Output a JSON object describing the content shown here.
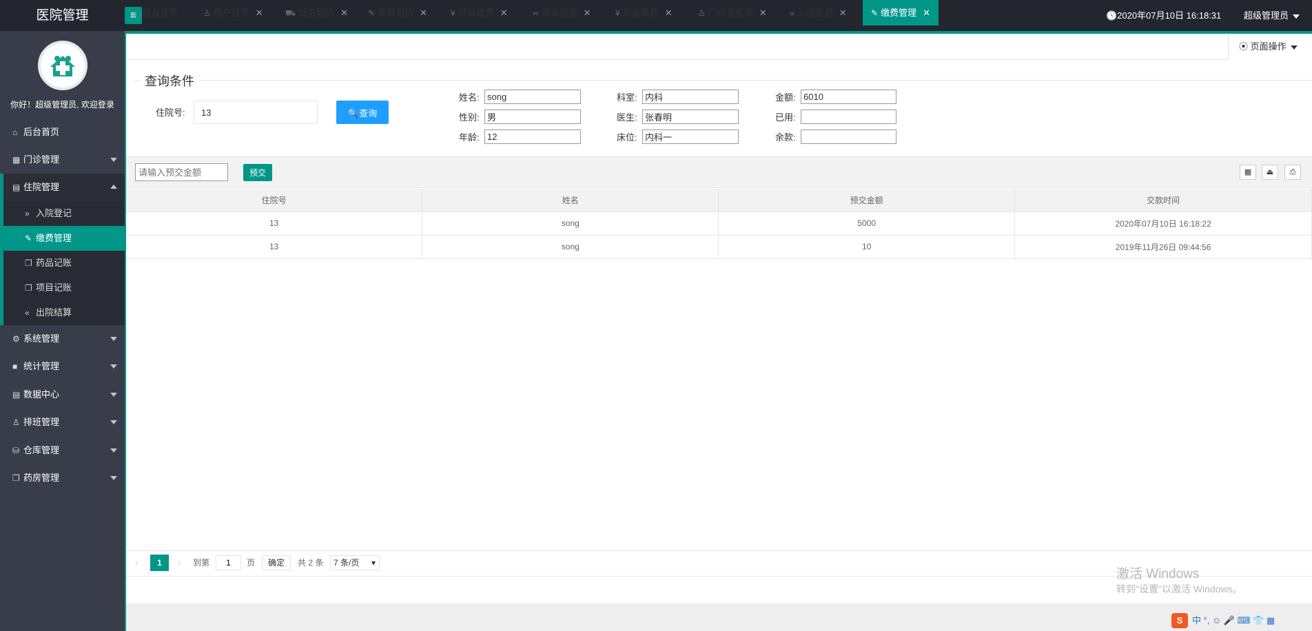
{
  "app": {
    "title": "医院管理",
    "menu_toggle": "≡",
    "datetime": "🕓2020年07月10日 16:18:31",
    "user": "超级管理员"
  },
  "sidebar": {
    "welcome": "你好！超级管理员, 欢迎登录",
    "items": [
      {
        "label": "后台首页",
        "icon": "⌂"
      },
      {
        "label": "门诊管理",
        "icon": "▦"
      },
      {
        "label": "住院管理",
        "icon": "▤"
      },
      {
        "label": "系统管理",
        "icon": "⚙"
      },
      {
        "label": "统计管理",
        "icon": "■"
      },
      {
        "label": "数据中心",
        "icon": "▤"
      },
      {
        "label": "排班管理",
        "icon": "♙"
      },
      {
        "label": "仓库管理",
        "icon": "⛁"
      },
      {
        "label": "药房管理",
        "icon": "❐"
      }
    ],
    "sub_items": [
      {
        "label": "入院登记",
        "icon": "»"
      },
      {
        "label": "缴费管理",
        "icon": "✎"
      },
      {
        "label": "药品记账",
        "icon": "❐"
      },
      {
        "label": "项目记账",
        "icon": "❐"
      },
      {
        "label": "出院结算",
        "icon": "«"
      }
    ]
  },
  "tabs": [
    {
      "label": "后台首页",
      "icon": "⌂"
    },
    {
      "label": "用户挂号",
      "icon": "♙"
    },
    {
      "label": "处方划价",
      "icon": "⛟"
    },
    {
      "label": "项目划价",
      "icon": "✎"
    },
    {
      "label": "项目缴费",
      "icon": "¥"
    },
    {
      "label": "项目检查",
      "icon": "∞"
    },
    {
      "label": "药品缴费",
      "icon": "¥"
    },
    {
      "label": "门诊患者库",
      "icon": "♙"
    },
    {
      "label": "入院登记",
      "icon": "»"
    },
    {
      "label": "缴费管理",
      "icon": "✎"
    }
  ],
  "tab_close": "✕",
  "page_op": "⦿ 页面操作",
  "query": {
    "legend": "查询条件",
    "inpatient_label": "住院号:",
    "inpatient_value": "13",
    "query_button": "🔍查询",
    "name_label": "姓名:",
    "name_value": "song",
    "gender_label": "性别:",
    "gender_value": "男",
    "age_label": "年龄:",
    "age_value": "12",
    "dept_label": "科室:",
    "dept_value": "内科",
    "doctor_label": "医生:",
    "doctor_value": "张春明",
    "bed_label": "床位:",
    "bed_value": "内科一",
    "amount_label": "金额:",
    "amount_value": "6010",
    "used_label": "已用:",
    "used_value": "",
    "balance_label": "余款:",
    "balance_value": ""
  },
  "toolbar": {
    "prepay_placeholder": "请输入预交金额",
    "prepay_button": "预交",
    "icons": [
      "columns-icon",
      "export-icon",
      "print-icon"
    ]
  },
  "table": {
    "headers": [
      "住院号",
      "姓名",
      "预交金额",
      "交款时间"
    ],
    "rows": [
      [
        "13",
        "song",
        "5000",
        "2020年07月10日 16:18:22"
      ],
      [
        "13",
        "song",
        "10",
        "2019年11月26日 09:44:56"
      ]
    ]
  },
  "pager": {
    "prev": "‹",
    "current": "1",
    "next": "›",
    "goto_label": "到第",
    "goto_value": "1",
    "page_unit": "页",
    "confirm": "确定",
    "total": "共 2 条",
    "per_page": "7 条/页"
  },
  "watermark": {
    "line1": "激活 Windows",
    "line2": "转到\"设置\"以激活 Windows。"
  },
  "tray": {
    "ime": "S",
    "text": "中 °, ☺ 🎤 ⌨ 👕 ▦"
  }
}
